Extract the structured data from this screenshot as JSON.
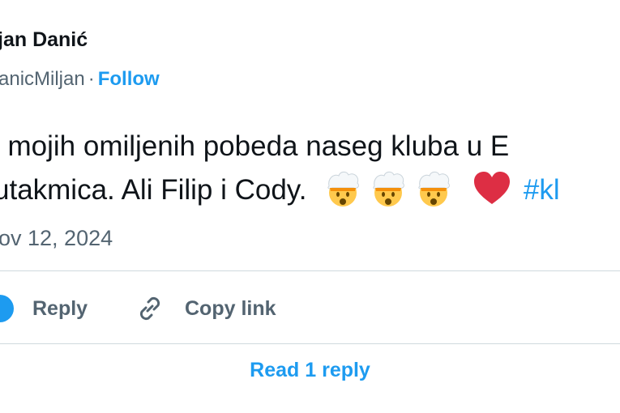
{
  "author": {
    "name": "jan Danić",
    "handle": "anicMiljan",
    "separator": "·",
    "follow_label": "Follow"
  },
  "tweet": {
    "line1": "l mojih omiljenih pobeda naseg kluba u E",
    "line2": "utakmica. Ali Filip i Cody.",
    "hashtag": "#kl",
    "emojis": [
      "exploding-head-icon",
      "exploding-head-icon",
      "exploding-head-icon",
      "red-heart-icon"
    ]
  },
  "date": "ov 12, 2024",
  "actions": {
    "reply_label": "Reply",
    "copy_link_label": "Copy link"
  },
  "read_replies_label": "Read 1 reply",
  "colors": {
    "accent": "#1d9bf0",
    "text": "#0f1419",
    "muted": "#536471",
    "divider": "#cfd9de",
    "heart": "#e0245e"
  }
}
